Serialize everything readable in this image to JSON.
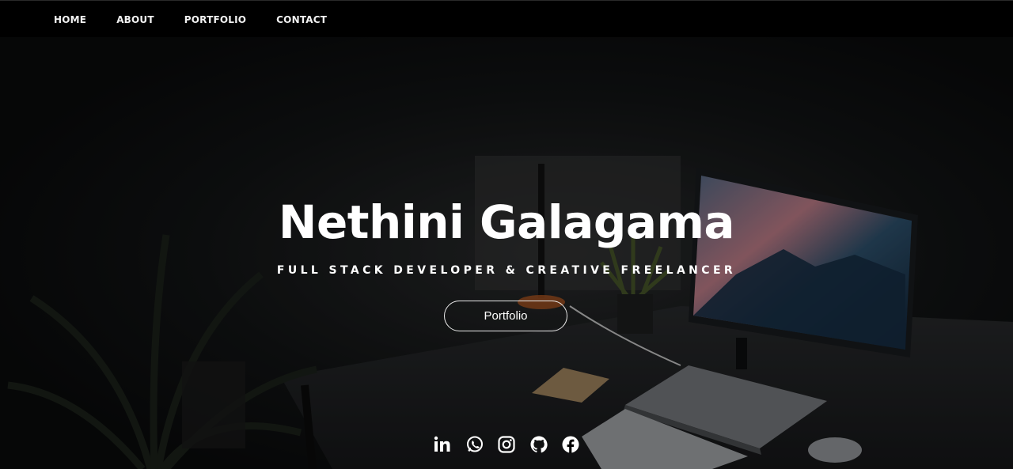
{
  "nav": {
    "items": [
      {
        "label": "HOME"
      },
      {
        "label": "ABOUT"
      },
      {
        "label": "PORTFOLIO"
      },
      {
        "label": "CONTACT"
      }
    ]
  },
  "hero": {
    "title": "Nethini Galagama",
    "subtitle": "FULL STACK DEVELOPER & CREATIVE FREELANCER",
    "button_label": "Portfolio",
    "background": "dark desk with monitor, laptop and plants"
  },
  "social": [
    {
      "icon": "linkedin-icon"
    },
    {
      "icon": "whatsapp-icon"
    },
    {
      "icon": "instagram-icon"
    },
    {
      "icon": "github-icon"
    },
    {
      "icon": "facebook-icon"
    }
  ],
  "colors": {
    "nav_background": "#000000",
    "text": "#ffffff",
    "hero_background": "#0b0c0d"
  }
}
